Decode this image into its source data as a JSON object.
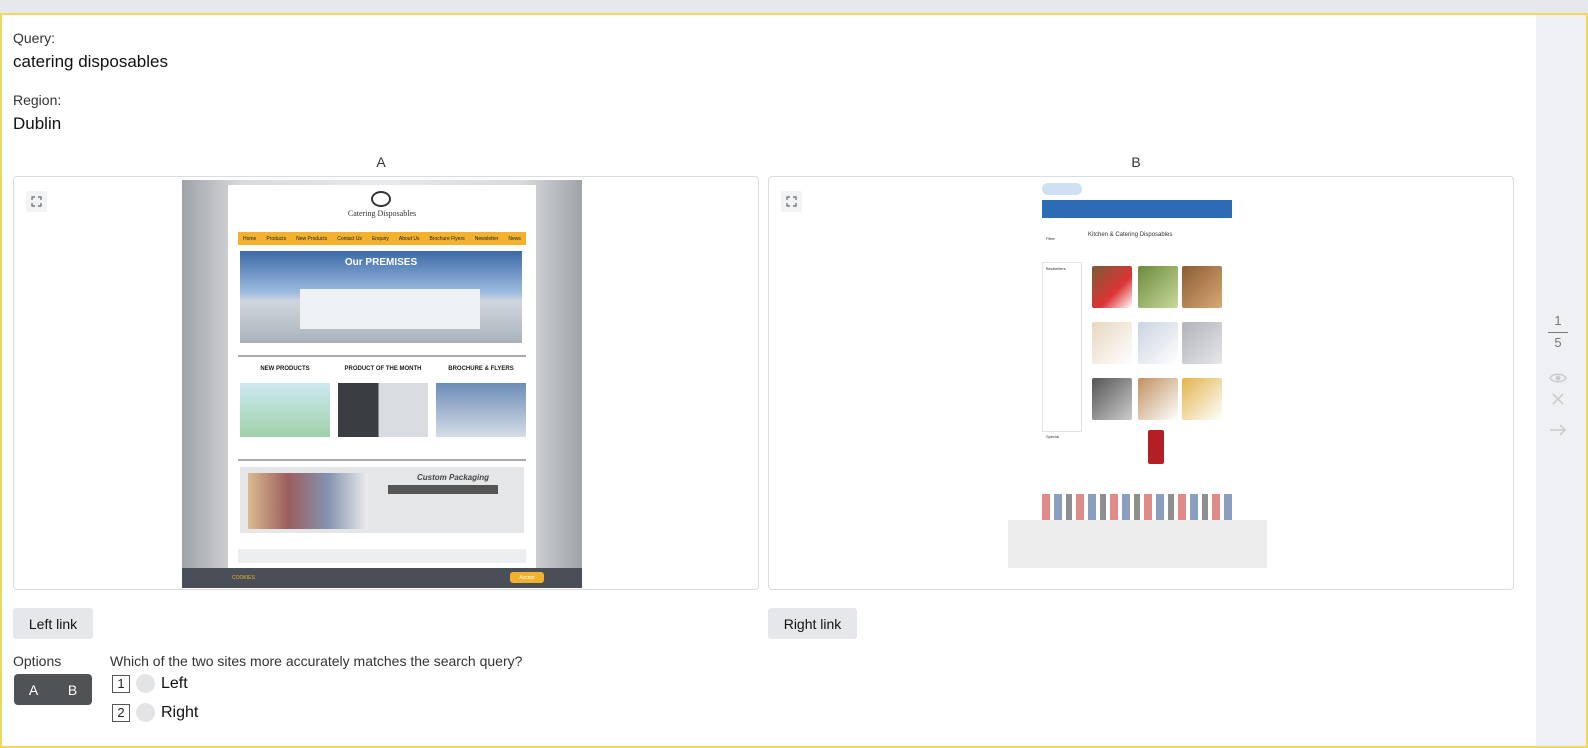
{
  "query": {
    "label": "Query:",
    "value": "catering disposables"
  },
  "region": {
    "label": "Region:",
    "value": "Dublin"
  },
  "columns": {
    "a": "A",
    "b": "B"
  },
  "site_a": {
    "brand": "Catering Disposables",
    "nav": [
      "Home",
      "Products",
      "New Products",
      "Contact Us",
      "Enquiry",
      "About Us",
      "Brochure Flyers",
      "Newsletter",
      "News"
    ],
    "hero_title": "Our PREMISES",
    "tiles": [
      "NEW PRODUCTS",
      "PRODUCT OF THE MONTH",
      "BROCHURE & FLYERS"
    ],
    "custom": "Custom Packaging",
    "cookie_label": "COOKIES",
    "accept": "Accept"
  },
  "site_b": {
    "heading": "Kitchen & Catering Disposables",
    "filter": "Filter",
    "bestsellers": "Bestsellers",
    "special": "Special"
  },
  "buttons": {
    "left_link": "Left link",
    "right_link": "Right link"
  },
  "options": {
    "label": "Options",
    "a": "A",
    "b": "B"
  },
  "question": {
    "text": "Which of the two sites more accurately matches the search query?",
    "choices": [
      {
        "key": "1",
        "label": "Left"
      },
      {
        "key": "2",
        "label": "Right"
      }
    ]
  },
  "pager": {
    "current": "1",
    "total": "5"
  },
  "colors": {
    "accent_border": "#f2d75a",
    "site_a_nav": "#f2b22e",
    "site_b_nav": "#2b6cb4"
  },
  "icons": [
    "expand-icon",
    "eye-icon",
    "close-icon",
    "arrow-right-icon"
  ]
}
